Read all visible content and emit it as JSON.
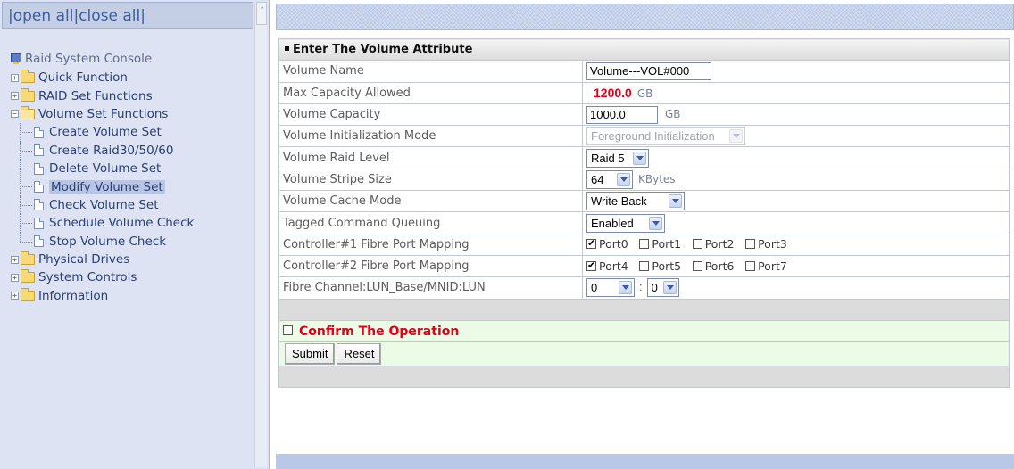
{
  "left_frame": {
    "header": {
      "prefix": "|",
      "open_all": "open all",
      "sep": "|",
      "close_all": "close all",
      "suffix": "|"
    },
    "tree": {
      "root": "Raid System Console",
      "items": [
        {
          "label": "Quick Function",
          "toggle": "+"
        },
        {
          "label": "RAID Set Functions",
          "toggle": "+"
        },
        {
          "label": "Volume Set Functions",
          "toggle": "−",
          "children": [
            "Create Volume Set",
            "Create Raid30/50/60",
            "Delete Volume Set",
            "Modify Volume Set",
            "Check Volume Set",
            "Schedule Volume Check",
            "Stop Volume Check"
          ],
          "selected_child": "Modify Volume Set"
        },
        {
          "label": "Physical Drives",
          "toggle": "+"
        },
        {
          "label": "System Controls",
          "toggle": "+"
        },
        {
          "label": "Information",
          "toggle": "+"
        }
      ]
    }
  },
  "form": {
    "title": "Enter The Volume Attribute",
    "volume_name": {
      "label": "Volume Name",
      "value": "Volume---VOL#000"
    },
    "max_capacity": {
      "label": "Max Capacity Allowed",
      "value": "1200.0",
      "unit": "GB"
    },
    "volume_capacity": {
      "label": "Volume Capacity",
      "value": "1000.0",
      "unit": "GB"
    },
    "init_mode": {
      "label": "Volume Initialization Mode",
      "value": "Foreground Initialization"
    },
    "raid_level": {
      "label": "Volume Raid Level",
      "value": "Raid 5"
    },
    "stripe_size": {
      "label": "Volume Stripe Size",
      "value": "64",
      "unit": "KBytes"
    },
    "cache_mode": {
      "label": "Volume Cache Mode",
      "value": "Write Back"
    },
    "tcq": {
      "label": "Tagged Command Queuing",
      "value": "Enabled"
    },
    "ctrl1_mapping": {
      "label": "Controller#1 Fibre Port Mapping",
      "ports": [
        {
          "label": "Port0",
          "checked": true
        },
        {
          "label": "Port1",
          "checked": false
        },
        {
          "label": "Port2",
          "checked": false
        },
        {
          "label": "Port3",
          "checked": false
        }
      ]
    },
    "ctrl2_mapping": {
      "label": "Controller#2 Fibre Port Mapping",
      "ports": [
        {
          "label": "Port4",
          "checked": true
        },
        {
          "label": "Port5",
          "checked": false
        },
        {
          "label": "Port6",
          "checked": false
        },
        {
          "label": "Port7",
          "checked": false
        }
      ]
    },
    "lun": {
      "label": "Fibre Channel:LUN_Base/MNID:LUN",
      "base": "0",
      "colon": ":",
      "lun": "0"
    },
    "confirm": {
      "label": "Confirm The Operation",
      "checked": false
    },
    "submit_label": "Submit",
    "reset_label": "Reset"
  },
  "colors": {
    "accent_red": "#e0001b",
    "confirm_bg": "#ebfbe6",
    "left_frame_bg": "#dde3f3"
  }
}
